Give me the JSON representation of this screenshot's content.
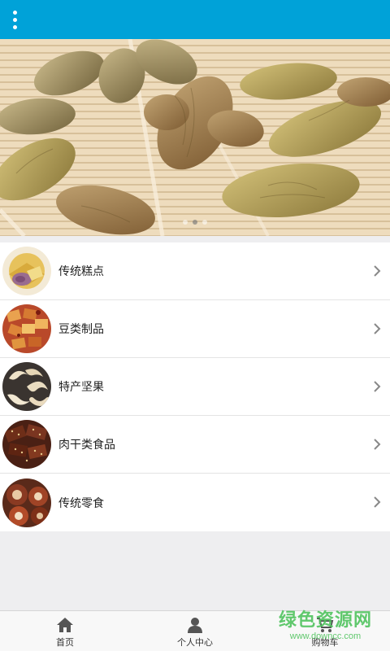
{
  "header": {
    "menu_icon": "more-vertical-icon",
    "bg_color": "#00a2d8"
  },
  "banner": {
    "image": "raisins-photo",
    "slide_count": 3,
    "active_slide": 2
  },
  "categories": [
    {
      "label": "传统糕点",
      "image": "mooncake-photo"
    },
    {
      "label": "豆类制品",
      "image": "tofu-photo"
    },
    {
      "label": "特产坚果",
      "image": "cashew-photo"
    },
    {
      "label": "肉干类食品",
      "image": "jerky-photo"
    },
    {
      "label": "传统零食",
      "image": "mushroom-snack-photo"
    }
  ],
  "tabbar": {
    "items": [
      {
        "label": "首页",
        "icon": "home-icon"
      },
      {
        "label": "个人中心",
        "icon": "user-icon"
      },
      {
        "label": "购物车",
        "icon": "cart-icon"
      }
    ]
  },
  "watermark": {
    "title": "绿色资源网",
    "url": "www.downcc.com",
    "color": "#4cc25a"
  }
}
